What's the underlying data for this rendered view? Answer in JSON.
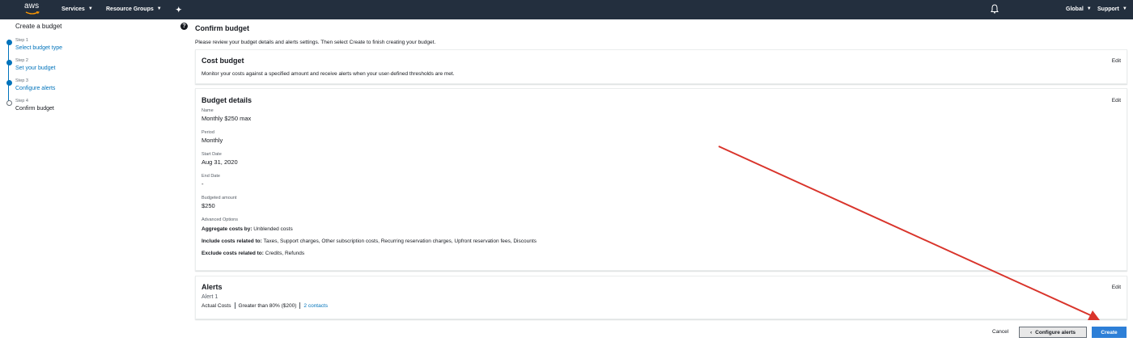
{
  "nav": {
    "logo": "aws",
    "services": "Services",
    "resource_groups": "Resource Groups",
    "region": "Global",
    "support": "Support",
    "icons": [
      "pin-icon",
      "bell-icon",
      "chevron-down-icon"
    ]
  },
  "sidebar": {
    "title": "Create a budget",
    "steps": [
      {
        "num": "Step 1",
        "label": "Select budget type"
      },
      {
        "num": "Step 2",
        "label": "Set your budget"
      },
      {
        "num": "Step 3",
        "label": "Configure alerts"
      },
      {
        "num": "Step 4",
        "label": "Confirm budget"
      }
    ]
  },
  "main": {
    "title": "Confirm budget",
    "intro": "Please review your budget details and alerts settings. Then select Create to finish creating your budget.",
    "edit_label": "Edit",
    "cost_budget": {
      "heading": "Cost budget",
      "description": "Monitor your costs against a specified amount and receive alerts when your user-defined thresholds are met."
    },
    "details": {
      "heading": "Budget details",
      "name_label": "Name",
      "name_value": "Monthly $250 max",
      "period_label": "Period",
      "period_value": "Monthly",
      "start_label": "Start Date",
      "start_value": "Aug 31, 2020",
      "end_label": "End Date",
      "end_value": "-",
      "amount_label": "Budgeted amount",
      "amount_value": "$250",
      "advanced_label": "Advanced Options",
      "aggregate_key": "Aggregate costs by:",
      "aggregate_value": " Unblended costs",
      "include_key": "Include costs related to:",
      "include_value": " Taxes, Support charges, Other subscription costs, Recurring reservation charges, Upfront reservation fees, Discounts",
      "exclude_key": "Exclude costs related to:",
      "exclude_value": " Credits, Refunds"
    },
    "alerts": {
      "heading": "Alerts",
      "alert_name": "Alert 1",
      "cost_type": "Actual Costs",
      "threshold": "Greater than 80% ($200)",
      "contacts": "2 contacts"
    }
  },
  "footer": {
    "cancel": "Cancel",
    "previous": "Configure alerts",
    "create": "Create"
  },
  "colors": {
    "nav_bg": "#232f3e",
    "link": "#0073bb",
    "primary_button": "#2d7fd7",
    "annotation_arrow": "#d9342b"
  }
}
